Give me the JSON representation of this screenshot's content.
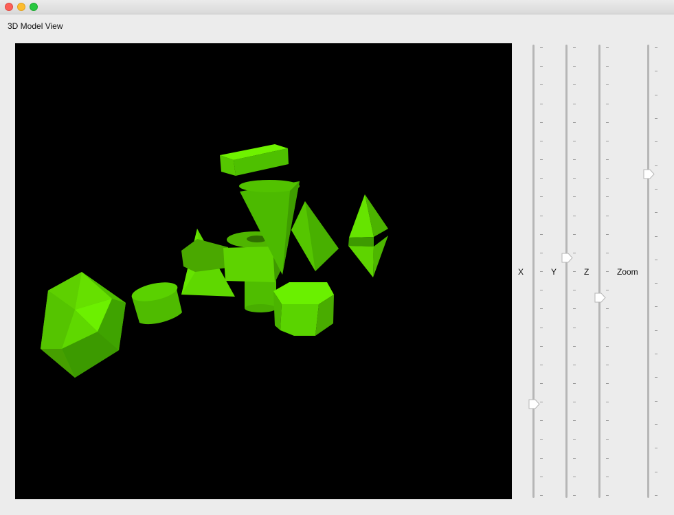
{
  "window": {
    "title": "",
    "traffic_lights": [
      "close",
      "minimize",
      "zoom"
    ]
  },
  "app": {
    "title": "3D Model View"
  },
  "viewport": {
    "background": "#000000",
    "shape_color": "#5fdc00",
    "shapes": [
      "icosahedron",
      "cylinder",
      "tetrahedron",
      "cube",
      "box",
      "cone",
      "torus",
      "cylinder",
      "hexagonal-prism",
      "pyramid",
      "octahedron"
    ]
  },
  "sliders": [
    {
      "id": "x",
      "label": "X",
      "value_fraction": 0.2
    },
    {
      "id": "y",
      "label": "Y",
      "value_fraction": 0.53
    },
    {
      "id": "z",
      "label": "Z",
      "value_fraction": 0.44
    },
    {
      "id": "zoom",
      "label": "Zoom",
      "value_fraction": 0.72
    }
  ]
}
